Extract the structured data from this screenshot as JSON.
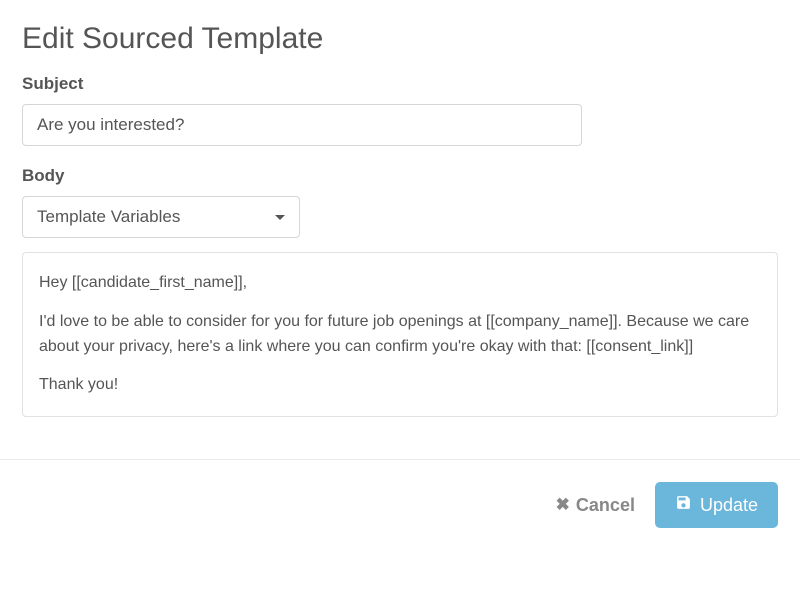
{
  "title": "Edit Sourced Template",
  "subject": {
    "label": "Subject",
    "value": "Are you interested?"
  },
  "body": {
    "label": "Body",
    "dropdown": {
      "selected": "Template Variables"
    },
    "content": {
      "greeting": "Hey [[candidate_first_name]],",
      "para1": "I'd love to be able to consider for you for future job openings at [[company_name]]. Because we care about your privacy, here's a link where you can confirm you're okay with that: [[consent_link]]",
      "closing": "Thank you!"
    }
  },
  "footer": {
    "cancel_label": "Cancel",
    "update_label": "Update"
  }
}
